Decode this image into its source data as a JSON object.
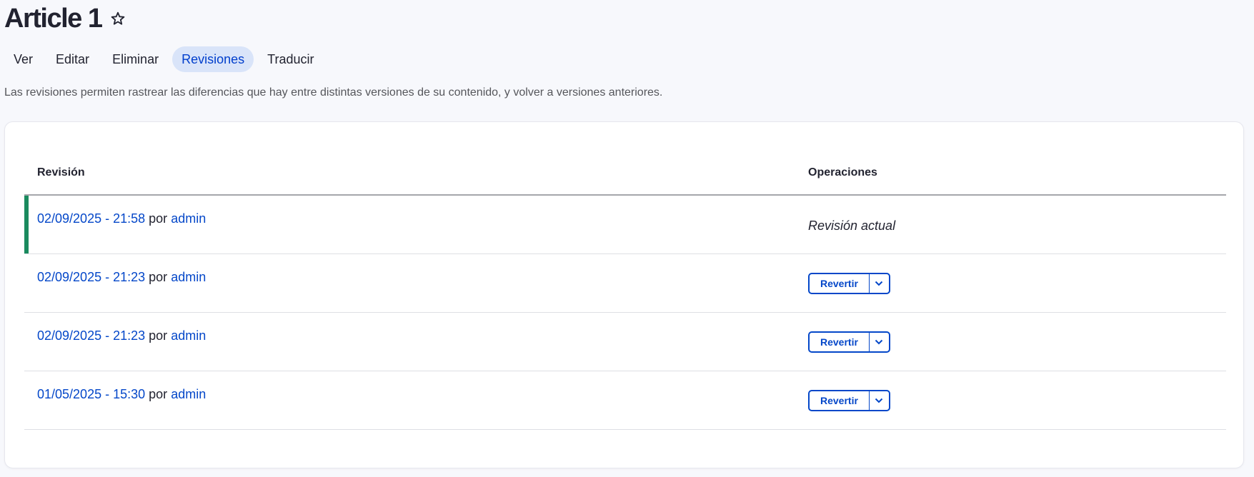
{
  "page": {
    "title": "Article 1"
  },
  "tabs": [
    {
      "label": "Ver"
    },
    {
      "label": "Editar"
    },
    {
      "label": "Eliminar"
    },
    {
      "label": "Revisiones",
      "active": true
    },
    {
      "label": "Traducir"
    }
  ],
  "description": "Las revisiones permiten rastrear las diferencias que hay entre distintas versiones de su contenido, y volver a versiones anteriores.",
  "table": {
    "headers": {
      "revision": "Revisión",
      "operations": "Operaciones"
    },
    "rows": [
      {
        "date": "02/09/2025 - 21:58",
        "by": "por",
        "author": "admin",
        "operation": "Revisión actual"
      },
      {
        "date": "02/09/2025 - 21:23",
        "by": "por",
        "author": "admin",
        "operation": "Revertir"
      },
      {
        "date": "02/09/2025 - 21:23",
        "by": "por",
        "author": "admin",
        "operation": "Revertir"
      },
      {
        "date": "01/05/2025 - 15:30",
        "by": "por",
        "author": "admin",
        "operation": "Revertir"
      }
    ]
  },
  "icons": {
    "favorite": "star-icon",
    "toggle": "chevron-down-icon"
  },
  "colors": {
    "accent": "#0447c9",
    "active_tab_bg": "#d9e4f9",
    "current_marker": "#1a8a5e"
  }
}
